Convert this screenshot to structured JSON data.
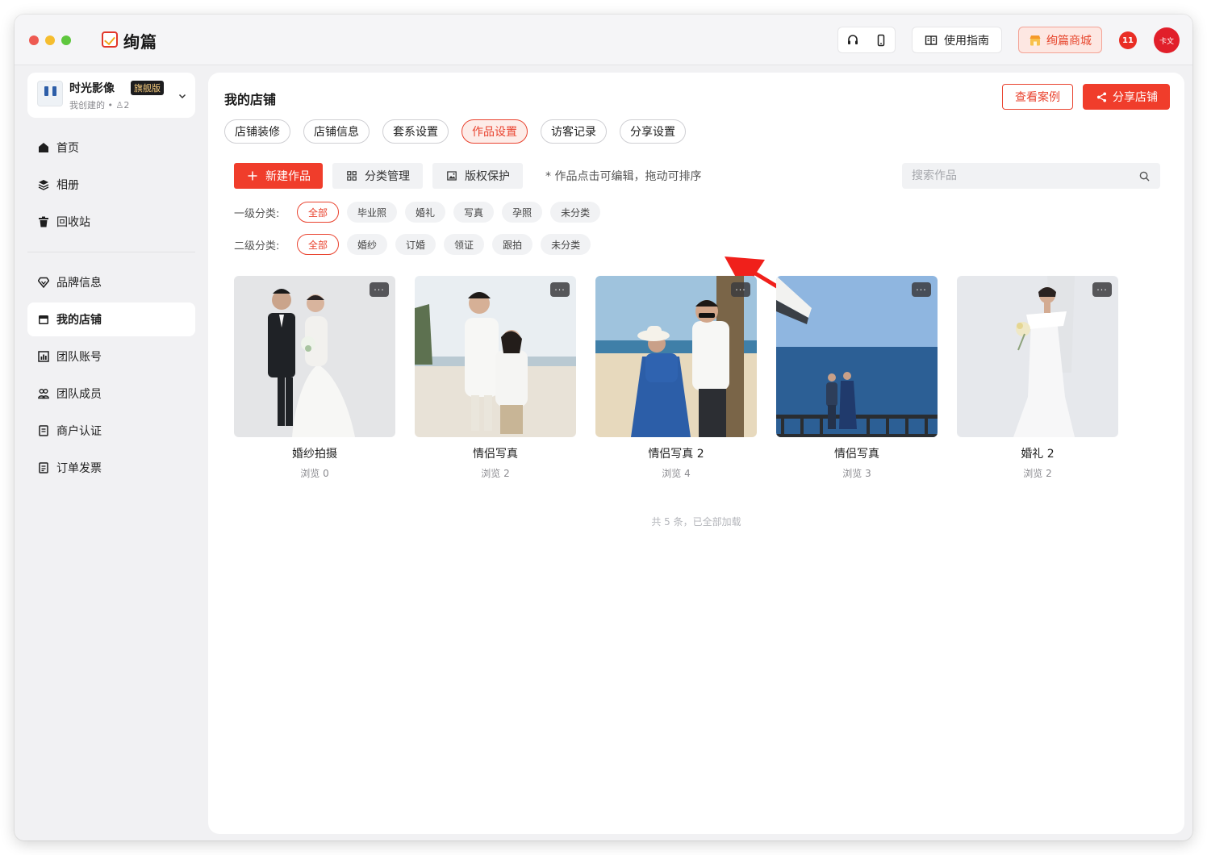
{
  "app": {
    "name": "绚篇"
  },
  "titlebar": {
    "guide_label": "使用指南",
    "mall_label": "绚篇商城",
    "badge_text": "11",
    "avatar_text": "卡文"
  },
  "account": {
    "name": "时光影像",
    "tier": "旗舰版",
    "sub": "我创建的 • ♙2"
  },
  "sidebar": {
    "items": [
      {
        "label": "首页",
        "icon": "home-icon"
      },
      {
        "label": "相册",
        "icon": "layers-icon"
      },
      {
        "label": "回收站",
        "icon": "trash-icon"
      },
      {
        "label": "品牌信息",
        "icon": "diamond-icon"
      },
      {
        "label": "我的店铺",
        "icon": "store-icon",
        "active": true
      },
      {
        "label": "团队账号",
        "icon": "chart-icon"
      },
      {
        "label": "团队成员",
        "icon": "team-icon"
      },
      {
        "label": "商户认证",
        "icon": "document-icon"
      },
      {
        "label": "订单发票",
        "icon": "invoice-icon"
      }
    ]
  },
  "main": {
    "title": "我的店铺",
    "view_cases_label": "查看案例",
    "share_shop_label": "分享店铺",
    "tabs": [
      "店铺装修",
      "店铺信息",
      "套系设置",
      "作品设置",
      "访客记录",
      "分享设置"
    ],
    "active_tab": "作品设置",
    "toolbar": {
      "new_label": "新建作品",
      "category_label": "分类管理",
      "copyright_label": "版权保护",
      "hint": "* 作品点击可编辑，拖动可排序"
    },
    "search": {
      "placeholder": "搜索作品"
    },
    "filters": {
      "level1_label": "一级分类:",
      "level1": [
        "全部",
        "毕业照",
        "婚礼",
        "写真",
        "孕照",
        "未分类"
      ],
      "level2_label": "二级分类:",
      "level2": [
        "全部",
        "婚纱",
        "订婚",
        "领证",
        "跟拍",
        "未分类"
      ]
    },
    "works": [
      {
        "title": "婚纱拍摄",
        "views": "浏览 0"
      },
      {
        "title": "情侣写真",
        "views": "浏览 2"
      },
      {
        "title": "情侣写真 2",
        "views": "浏览 4"
      },
      {
        "title": "情侣写真",
        "views": "浏览 3"
      },
      {
        "title": "婚礼 2",
        "views": "浏览 2"
      }
    ],
    "footer_note": "共 5 条，已全部加载"
  },
  "colors": {
    "accent": "#f03d2b",
    "sidebar_bg": "#f1f1f3",
    "chip_bg": "#f1f2f4"
  }
}
